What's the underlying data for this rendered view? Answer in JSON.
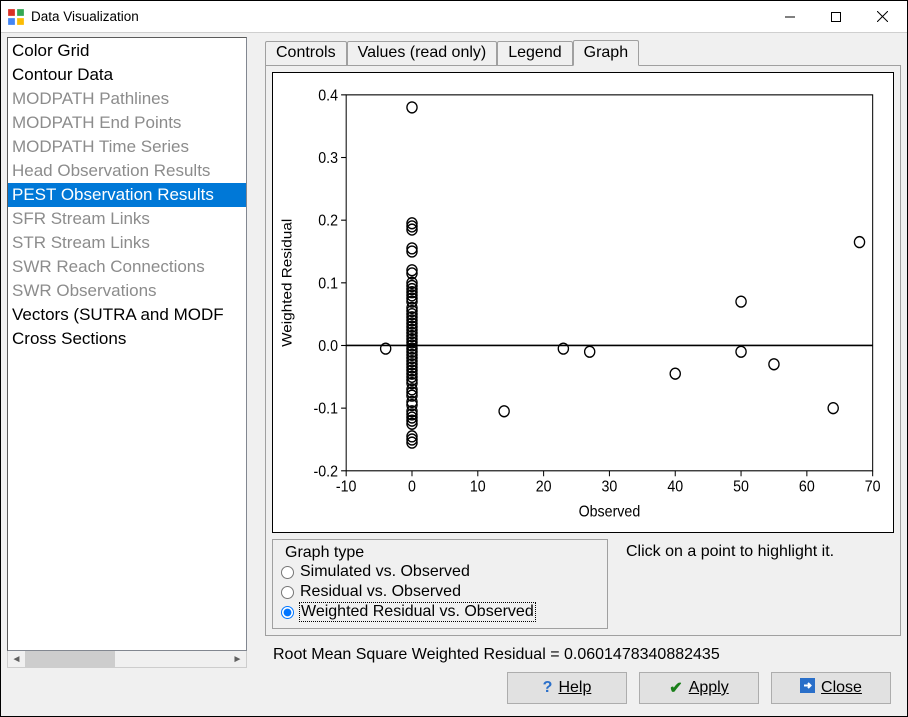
{
  "window": {
    "title": "Data Visualization"
  },
  "sidebar": {
    "items": [
      {
        "label": "Color Grid",
        "disabled": false
      },
      {
        "label": "Contour Data",
        "disabled": false
      },
      {
        "label": "MODPATH Pathlines",
        "disabled": true
      },
      {
        "label": "MODPATH End Points",
        "disabled": true
      },
      {
        "label": "MODPATH Time Series",
        "disabled": true
      },
      {
        "label": "Head Observation Results",
        "disabled": true
      },
      {
        "label": "PEST Observation Results",
        "disabled": true,
        "selected": true
      },
      {
        "label": "SFR Stream Links",
        "disabled": true
      },
      {
        "label": "STR Stream Links",
        "disabled": true
      },
      {
        "label": "SWR Reach Connections",
        "disabled": true
      },
      {
        "label": "SWR Observations",
        "disabled": true
      },
      {
        "label": "Vectors (SUTRA and MODF",
        "disabled": false
      },
      {
        "label": "Cross Sections",
        "disabled": false
      }
    ]
  },
  "tabs": {
    "items": [
      {
        "label": "Controls"
      },
      {
        "label": "Values (read only)"
      },
      {
        "label": "Legend"
      },
      {
        "label": "Graph",
        "active": true
      }
    ]
  },
  "graph_type": {
    "legend": "Graph type",
    "options": [
      {
        "label": "Simulated vs. Observed",
        "checked": false
      },
      {
        "label": "Residual vs. Observed",
        "checked": false
      },
      {
        "label": "Weighted Residual vs. Observed",
        "checked": true
      }
    ]
  },
  "hint": "Click on a point to highlight it.",
  "status": "Root Mean Square Weighted Residual = 0.0601478340882435",
  "buttons": {
    "help": "Help",
    "apply": "Apply",
    "close": "Close"
  },
  "chart_data": {
    "type": "scatter",
    "xlabel": "Observed",
    "ylabel": "Weighted Residual",
    "xlim": [
      -10,
      70
    ],
    "ylim": [
      -0.2,
      0.4
    ],
    "xticks": [
      -10,
      0,
      10,
      20,
      30,
      40,
      50,
      60,
      70
    ],
    "yticks": [
      -0.2,
      -0.1,
      -0.0,
      0.1,
      0.2,
      0.3,
      0.4
    ],
    "series": [
      {
        "name": "Weighted Residual vs. Observed",
        "points": [
          [
            -4,
            -0.005
          ],
          [
            0,
            0.38
          ],
          [
            0,
            0.195
          ],
          [
            0,
            0.19
          ],
          [
            0,
            0.185
          ],
          [
            0,
            0.155
          ],
          [
            0,
            0.15
          ],
          [
            0,
            0.12
          ],
          [
            0,
            0.115
          ],
          [
            0,
            0.1
          ],
          [
            0,
            0.095
          ],
          [
            0,
            0.09
          ],
          [
            0,
            0.085
          ],
          [
            0,
            0.08
          ],
          [
            0,
            0.075
          ],
          [
            0,
            0.07
          ],
          [
            0,
            0.06
          ],
          [
            0,
            0.055
          ],
          [
            0,
            0.05
          ],
          [
            0,
            0.045
          ],
          [
            0,
            0.04
          ],
          [
            0,
            0.035
          ],
          [
            0,
            0.03
          ],
          [
            0,
            0.025
          ],
          [
            0,
            0.02
          ],
          [
            0,
            0.015
          ],
          [
            0,
            0.01
          ],
          [
            0,
            0.005
          ],
          [
            0,
            0.0
          ],
          [
            0,
            -0.005
          ],
          [
            0,
            -0.01
          ],
          [
            0,
            -0.015
          ],
          [
            0,
            -0.02
          ],
          [
            0,
            -0.025
          ],
          [
            0,
            -0.03
          ],
          [
            0,
            -0.035
          ],
          [
            0,
            -0.04
          ],
          [
            0,
            -0.045
          ],
          [
            0,
            -0.05
          ],
          [
            0,
            -0.055
          ],
          [
            0,
            -0.06
          ],
          [
            0,
            -0.07
          ],
          [
            0,
            -0.075
          ],
          [
            0,
            -0.08
          ],
          [
            0,
            -0.09
          ],
          [
            0,
            -0.095
          ],
          [
            0,
            -0.105
          ],
          [
            0,
            -0.11
          ],
          [
            0,
            -0.115
          ],
          [
            0,
            -0.12
          ],
          [
            0,
            -0.125
          ],
          [
            0,
            -0.145
          ],
          [
            0,
            -0.15
          ],
          [
            0,
            -0.155
          ],
          [
            14,
            -0.105
          ],
          [
            23,
            -0.005
          ],
          [
            27,
            -0.01
          ],
          [
            40,
            -0.045
          ],
          [
            50,
            0.07
          ],
          [
            50,
            -0.01
          ],
          [
            55,
            -0.03
          ],
          [
            64,
            -0.1
          ],
          [
            68,
            0.165
          ]
        ]
      }
    ]
  }
}
